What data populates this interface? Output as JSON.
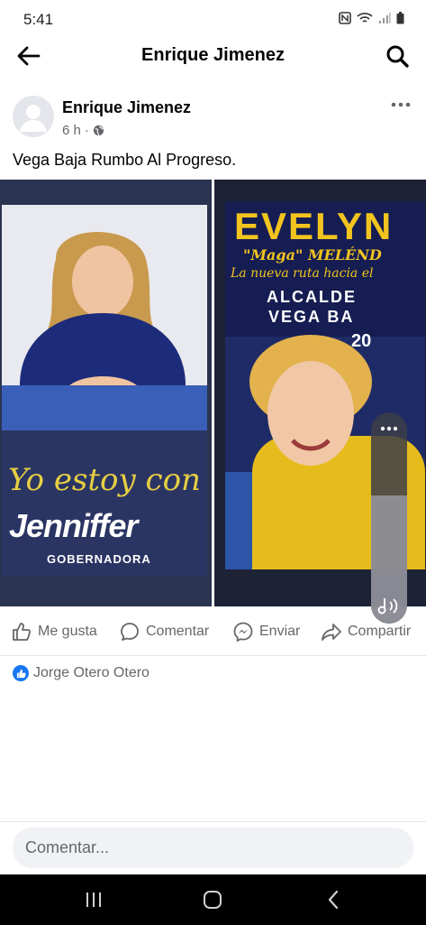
{
  "status_bar": {
    "time": "5:41"
  },
  "header": {
    "title": "Enrique Jimenez"
  },
  "post": {
    "author": "Enrique Jimenez",
    "time_ago": "6 h",
    "meta_separator": "·",
    "text": "Vega Baja Rumbo Al Progreso.",
    "photo_left": {
      "slogan": "Yo estoy con",
      "name": "Jenniffer",
      "role": "GOBERNADORA"
    },
    "photo_right": {
      "first_name": "EVELYN",
      "nickname": "\"Maga\" MELÉND",
      "tagline": "La nueva ruta hacia el",
      "office_line1": "ALCALDE",
      "office_line2": "VEGA BA",
      "year_fragment": "20"
    }
  },
  "actions": {
    "like": "Me gusta",
    "comment": "Comentar",
    "send": "Enviar",
    "share": "Compartir"
  },
  "reactions": {
    "names": "Jorge Otero Otero"
  },
  "comment_input": {
    "placeholder": "Comentar..."
  },
  "colors": {
    "facebook_blue": "#1877f2",
    "text_secondary": "#65676b"
  }
}
